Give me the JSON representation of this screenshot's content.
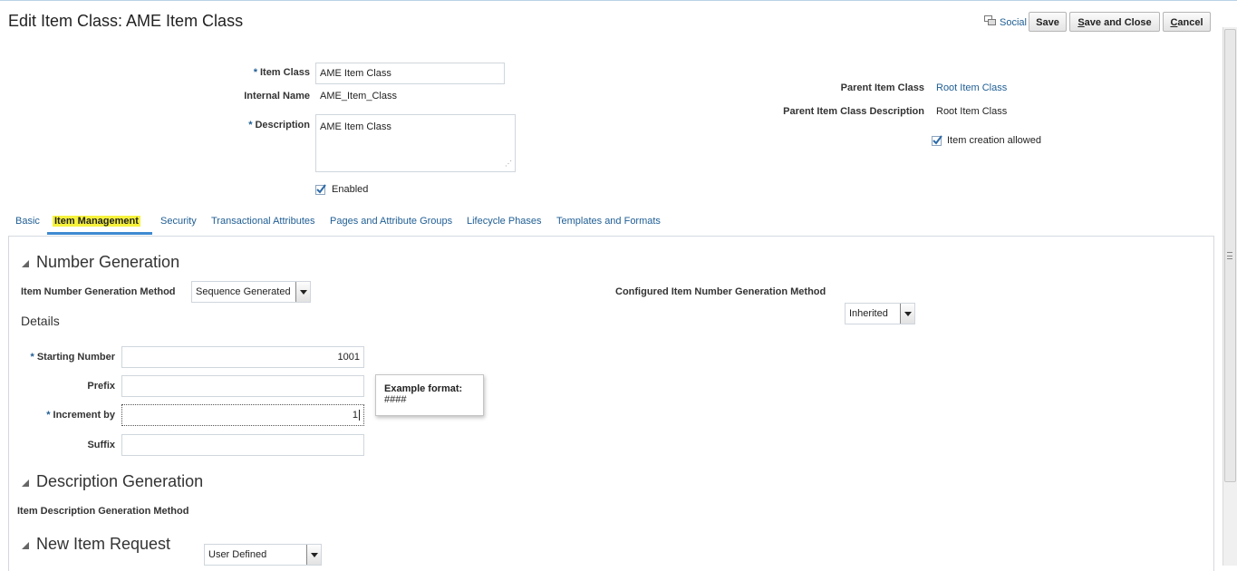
{
  "header": {
    "title": "Edit Item Class: AME Item Class",
    "social_label": "Social",
    "save_label": "Save",
    "save_close_label": "Save and Close",
    "cancel_label": "Cancel"
  },
  "form": {
    "item_class": {
      "label": "Item Class",
      "value": "AME Item Class"
    },
    "internal_name": {
      "label": "Internal Name",
      "value": "AME_Item_Class"
    },
    "description": {
      "label": "Description",
      "value": "AME Item Class"
    },
    "enabled": {
      "label": "Enabled",
      "checked": true
    },
    "parent_item_class": {
      "label": "Parent Item Class",
      "value": "Root Item Class"
    },
    "parent_item_class_description": {
      "label": "Parent Item Class Description",
      "value": "Root Item Class"
    },
    "item_creation_allowed": {
      "label": "Item creation allowed",
      "checked": true
    }
  },
  "tabs": [
    {
      "label": "Basic"
    },
    {
      "label": "Item Management",
      "active": true
    },
    {
      "label": "Security"
    },
    {
      "label": "Transactional Attributes"
    },
    {
      "label": "Pages and Attribute Groups"
    },
    {
      "label": "Lifecycle Phases"
    },
    {
      "label": "Templates and Formats"
    }
  ],
  "number_generation": {
    "title": "Number Generation",
    "method_label": "Item Number Generation Method",
    "method_value": "Sequence Generated",
    "configured_label": "Configured Item Number Generation Method",
    "configured_value": "Inherited",
    "details_title": "Details",
    "starting_number": {
      "label": "Starting Number",
      "value": "1001"
    },
    "prefix": {
      "label": "Prefix",
      "value": ""
    },
    "increment_by": {
      "label": "Increment by",
      "value": "1"
    },
    "suffix": {
      "label": "Suffix",
      "value": ""
    },
    "tooltip": {
      "title": "Example format:",
      "text": "####"
    }
  },
  "description_generation": {
    "title": "Description Generation",
    "method_label": "Item Description Generation Method",
    "method_value": "User Defined"
  },
  "new_item_request": {
    "title": "New Item Request"
  },
  "colors": {
    "link": "#1f5e94",
    "highlight": "#f6f23c",
    "tab_underline": "#3e8ad0"
  }
}
